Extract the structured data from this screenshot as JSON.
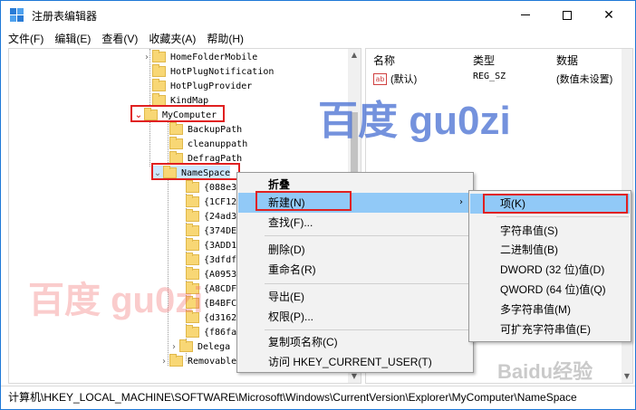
{
  "window": {
    "title": "注册表编辑器",
    "minimize_glyph": "—",
    "maximize_glyph": "☐",
    "close_glyph": "✕"
  },
  "menu": [
    "文件(F)",
    "编辑(E)",
    "查看(V)",
    "收藏夹(A)",
    "帮助(H)"
  ],
  "tree": {
    "items": [
      {
        "label": "HomeFolderMobile"
      },
      {
        "label": "HotPlugNotification"
      },
      {
        "label": "HotPlugProvider"
      },
      {
        "label": "KindMap"
      },
      {
        "label": "MyComputer"
      },
      {
        "label": "BackupPath"
      },
      {
        "label": "cleanuppath"
      },
      {
        "label": "DefragPath"
      },
      {
        "label": "NameSpace"
      },
      {
        "label": "{088e3"
      },
      {
        "label": "{1CF12"
      },
      {
        "label": "{24ad3"
      },
      {
        "label": "{374DE"
      },
      {
        "label": "{3ADD1"
      },
      {
        "label": "{3dfdf"
      },
      {
        "label": "{A0953"
      },
      {
        "label": "{A8CDF"
      },
      {
        "label": "{B4BFC"
      },
      {
        "label": "{d3162"
      },
      {
        "label": "{f86fa"
      },
      {
        "label": "Delega"
      },
      {
        "label": "Removable"
      }
    ]
  },
  "values_pane": {
    "headers": {
      "name": "名称",
      "type": "类型",
      "data": "数据"
    },
    "rows": [
      {
        "icon": "ab",
        "name": "(默认)",
        "type": "REG_SZ",
        "data": "(数值未设置)"
      }
    ]
  },
  "context_menu": {
    "items": [
      "折叠",
      "新建(N)",
      "查找(F)...",
      "删除(D)",
      "重命名(R)",
      "导出(E)",
      "权限(P)...",
      "复制项名称(C)",
      "访问 HKEY_CURRENT_USER(T)"
    ]
  },
  "submenu": {
    "items": [
      "项(K)",
      "字符串值(S)",
      "二进制值(B)",
      "DWORD (32 位)值(D)",
      "QWORD (64 位)值(Q)",
      "多字符串值(M)",
      "可扩充字符串值(E)"
    ]
  },
  "statusbar": {
    "path": "计算机\\HKEY_LOCAL_MACHINE\\SOFTWARE\\Microsoft\\Windows\\CurrentVersion\\Explorer\\MyComputer\\NameSpace"
  },
  "watermarks": {
    "blue": "百度 gu0zi",
    "pink": "百度 gu0zi",
    "baidu": "Baidu经验"
  },
  "colors": {
    "highlight_red": "#e02020",
    "menu_hover": "#91c9f7",
    "folder": "#f8d775",
    "accent": "#1e78d7"
  }
}
